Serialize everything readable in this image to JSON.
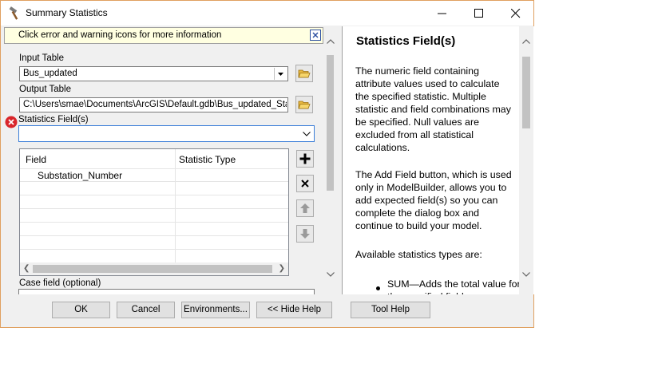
{
  "window": {
    "title": "Summary Statistics",
    "controls": {
      "minimize": "minimize-icon",
      "maximize": "maximize-icon",
      "close": "close-icon"
    }
  },
  "info_bar": {
    "text": "Click error and warning icons for more information"
  },
  "form": {
    "input_table_label": "Input Table",
    "input_table_value": "Bus_updated",
    "output_table_label": "Output Table",
    "output_table_value": "C:\\Users\\smae\\Documents\\ArcGIS\\Default.gdb\\Bus_updated_Statis",
    "statistics_fields_label": "Statistics Field(s)",
    "statistics_fields_value": "",
    "grid": {
      "columns": [
        "Field",
        "Statistic Type"
      ],
      "rows": [
        {
          "field": "Substation_Number",
          "statistic_type": ""
        }
      ]
    },
    "case_field_label": "Case field (optional)"
  },
  "buttons": {
    "ok": "OK",
    "cancel": "Cancel",
    "environments": "Environments...",
    "hide_help": "<< Hide Help",
    "tool_help": "Tool Help"
  },
  "help": {
    "title": "Statistics Field(s)",
    "paragraph1": "The numeric field containing attribute values used to calculate the specified statistic. Multiple statistic and field combinations may be specified. Null values are excluded from all statistical calculations.",
    "paragraph2": "The Add Field button, which is used only in ModelBuilder, allows you to add expected field(s) so you can complete the dialog box and continue to build your model.",
    "paragraph3": "Available statistics types are:",
    "list_item1": "SUM—Adds the total value for the specified field."
  },
  "colors": {
    "info_bg": "#ffffe1",
    "focus_border": "#3c7fd8",
    "error_red": "#d9262b",
    "window_border": "#e0a060"
  }
}
